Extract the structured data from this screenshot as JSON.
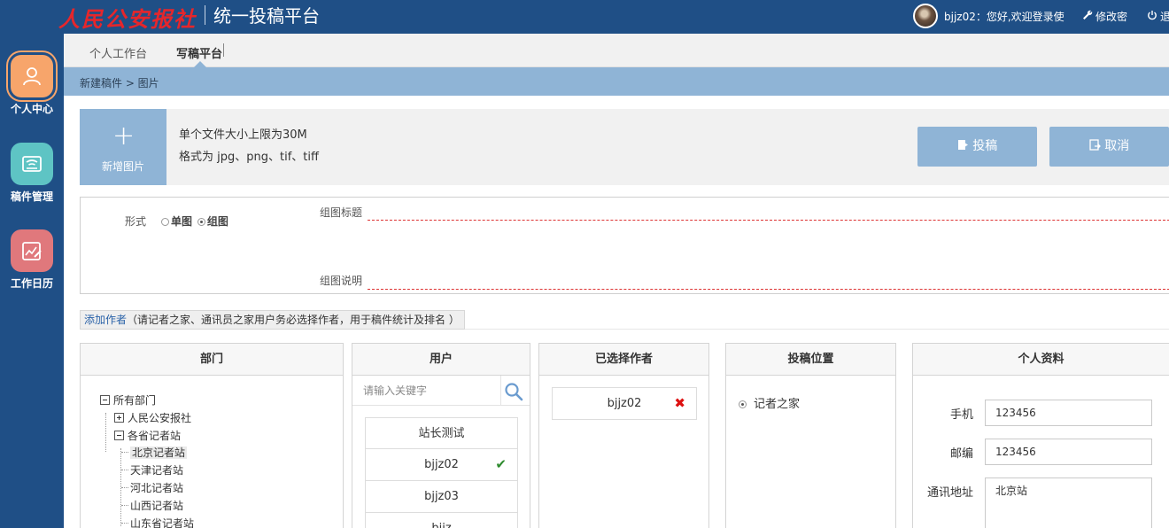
{
  "header": {
    "logo_text": "人民公安报社",
    "platform_title": "统一投稿平台",
    "welcome": "bjjz02：您好,欢迎登录使",
    "change_password": "修改密",
    "logout": "退"
  },
  "sidebar": {
    "items": [
      {
        "label": "个人中心",
        "icon": "user-icon",
        "color": "#f7a56b"
      },
      {
        "label": "稿件管理",
        "icon": "inbox-icon",
        "color": "#5ec4c4"
      },
      {
        "label": "工作日历",
        "icon": "calendar-edit-icon",
        "color": "#e0787c"
      }
    ]
  },
  "tabs": {
    "items": [
      "个人工作台",
      "写稿平台"
    ],
    "active": "写稿平台"
  },
  "breadcrumb": "新建稿件 > 图片",
  "upload": {
    "add_label": "新增图片",
    "note_size": "单个文件大小上限为30M",
    "note_format": "格式为 jpg、png、tif、tiff",
    "submit_label": "投稿",
    "cancel_label": "取消"
  },
  "form": {
    "format_label": "形式",
    "option_single": "单图",
    "option_group": "组图",
    "selected_option": "组图",
    "group_title_label": "组图标题",
    "group_desc_label": "组图说明"
  },
  "author": {
    "add_label": "添加作者",
    "hint": "（请记者之家、通讯员之家用户务必选择作者，用于稿件统计及排名 ）"
  },
  "panels": {
    "dept": {
      "title": "部门",
      "tree": [
        {
          "label": "所有部门",
          "level": 0,
          "toggle": "minus"
        },
        {
          "label": "人民公安报社",
          "level": 1,
          "toggle": "plus"
        },
        {
          "label": "各省记者站",
          "level": 1,
          "toggle": "minus"
        },
        {
          "label": "北京记者站",
          "level": 2,
          "selected": true
        },
        {
          "label": "天津记者站",
          "level": 2
        },
        {
          "label": "河北记者站",
          "level": 2
        },
        {
          "label": "山西记者站",
          "level": 2
        },
        {
          "label": "山东省记者站",
          "level": 2
        }
      ]
    },
    "users": {
      "title": "用户",
      "search_placeholder": "请输入关键字",
      "list": [
        {
          "name": "站长测试",
          "checked": false
        },
        {
          "name": "bjjz02",
          "checked": true
        },
        {
          "name": "bjjz03",
          "checked": false
        },
        {
          "name": "bjjz",
          "checked": false
        }
      ]
    },
    "selected": {
      "title": "已选择作者",
      "items": [
        "bjjz02"
      ]
    },
    "position": {
      "title": "投稿位置",
      "option": "记者之家"
    },
    "profile": {
      "title": "个人资料",
      "phone_label": "手机",
      "phone_value": "123456",
      "postcode_label": "邮编",
      "postcode_value": "123456",
      "address_label": "通讯地址",
      "address_value": "北京站"
    }
  },
  "colors": {
    "topbar": "#1f4f86",
    "accent": "#8fb4d6",
    "active_icon": "#f7a56b",
    "check": "#2e8b2e",
    "remove": "#d11111"
  }
}
